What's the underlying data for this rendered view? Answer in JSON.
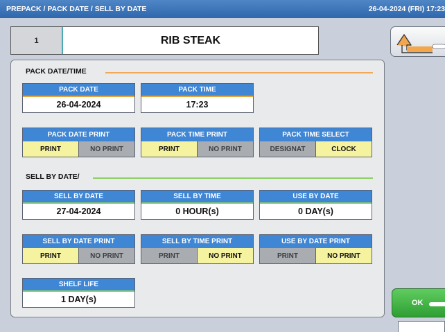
{
  "titlebar": {
    "title": "PREPACK / PACK DATE / SELL BY DATE",
    "datetime": "26-04-2024 (FRI)  17:23"
  },
  "header": {
    "number": "1",
    "product_name": "RIB STEAK"
  },
  "buttons": {
    "ok_label": "OK",
    "back_icon": "return-arrow-icon"
  },
  "pack_section": {
    "title": "PACK DATE/TIME",
    "pack_date": {
      "label": "PACK DATE",
      "value": "26-04-2024"
    },
    "pack_time": {
      "label": "PACK TIME",
      "value": "17:23"
    },
    "pack_date_print": {
      "label": "PACK DATE PRINT",
      "opt1": "PRINT",
      "opt2": "NO PRINT",
      "selected": "PRINT"
    },
    "pack_time_print": {
      "label": "PACK TIME PRINT",
      "opt1": "PRINT",
      "opt2": "NO PRINT",
      "selected": "PRINT"
    },
    "pack_time_select": {
      "label": "PACK TIME SELECT",
      "opt1": "DESIGNAT",
      "opt2": "CLOCK",
      "selected": "CLOCK"
    }
  },
  "sell_section": {
    "title": "SELL BY DATE/",
    "sell_by_date": {
      "label": "SELL BY DATE",
      "value": "27-04-2024"
    },
    "sell_by_time": {
      "label": "SELL BY TIME",
      "value": "0 HOUR(s)"
    },
    "use_by_date": {
      "label": "USE BY DATE",
      "value": "0 DAY(s)"
    },
    "sell_by_date_print": {
      "label": "SELL BY DATE PRINT",
      "opt1": "PRINT",
      "opt2": "NO PRINT",
      "selected": "PRINT"
    },
    "sell_by_time_print": {
      "label": "SELL BY TIME PRINT",
      "opt1": "PRINT",
      "opt2": "NO PRINT",
      "selected": "NO PRINT"
    },
    "use_by_date_print": {
      "label": "USE BY DATE PRINT",
      "opt1": "PRINT",
      "opt2": "NO PRINT",
      "selected": "NO PRINT"
    },
    "shelf_life": {
      "label": "SHELF LIFE",
      "value": "1 DAY(s)"
    }
  },
  "colors": {
    "header_blue": "#3f86d4",
    "selected_yellow": "#f6f3a0",
    "unselected_gray": "#a9acb1",
    "pack_section_line": "#f2a857",
    "sell_section_line": "#8ccf63",
    "ok_green": "#3fae42"
  }
}
